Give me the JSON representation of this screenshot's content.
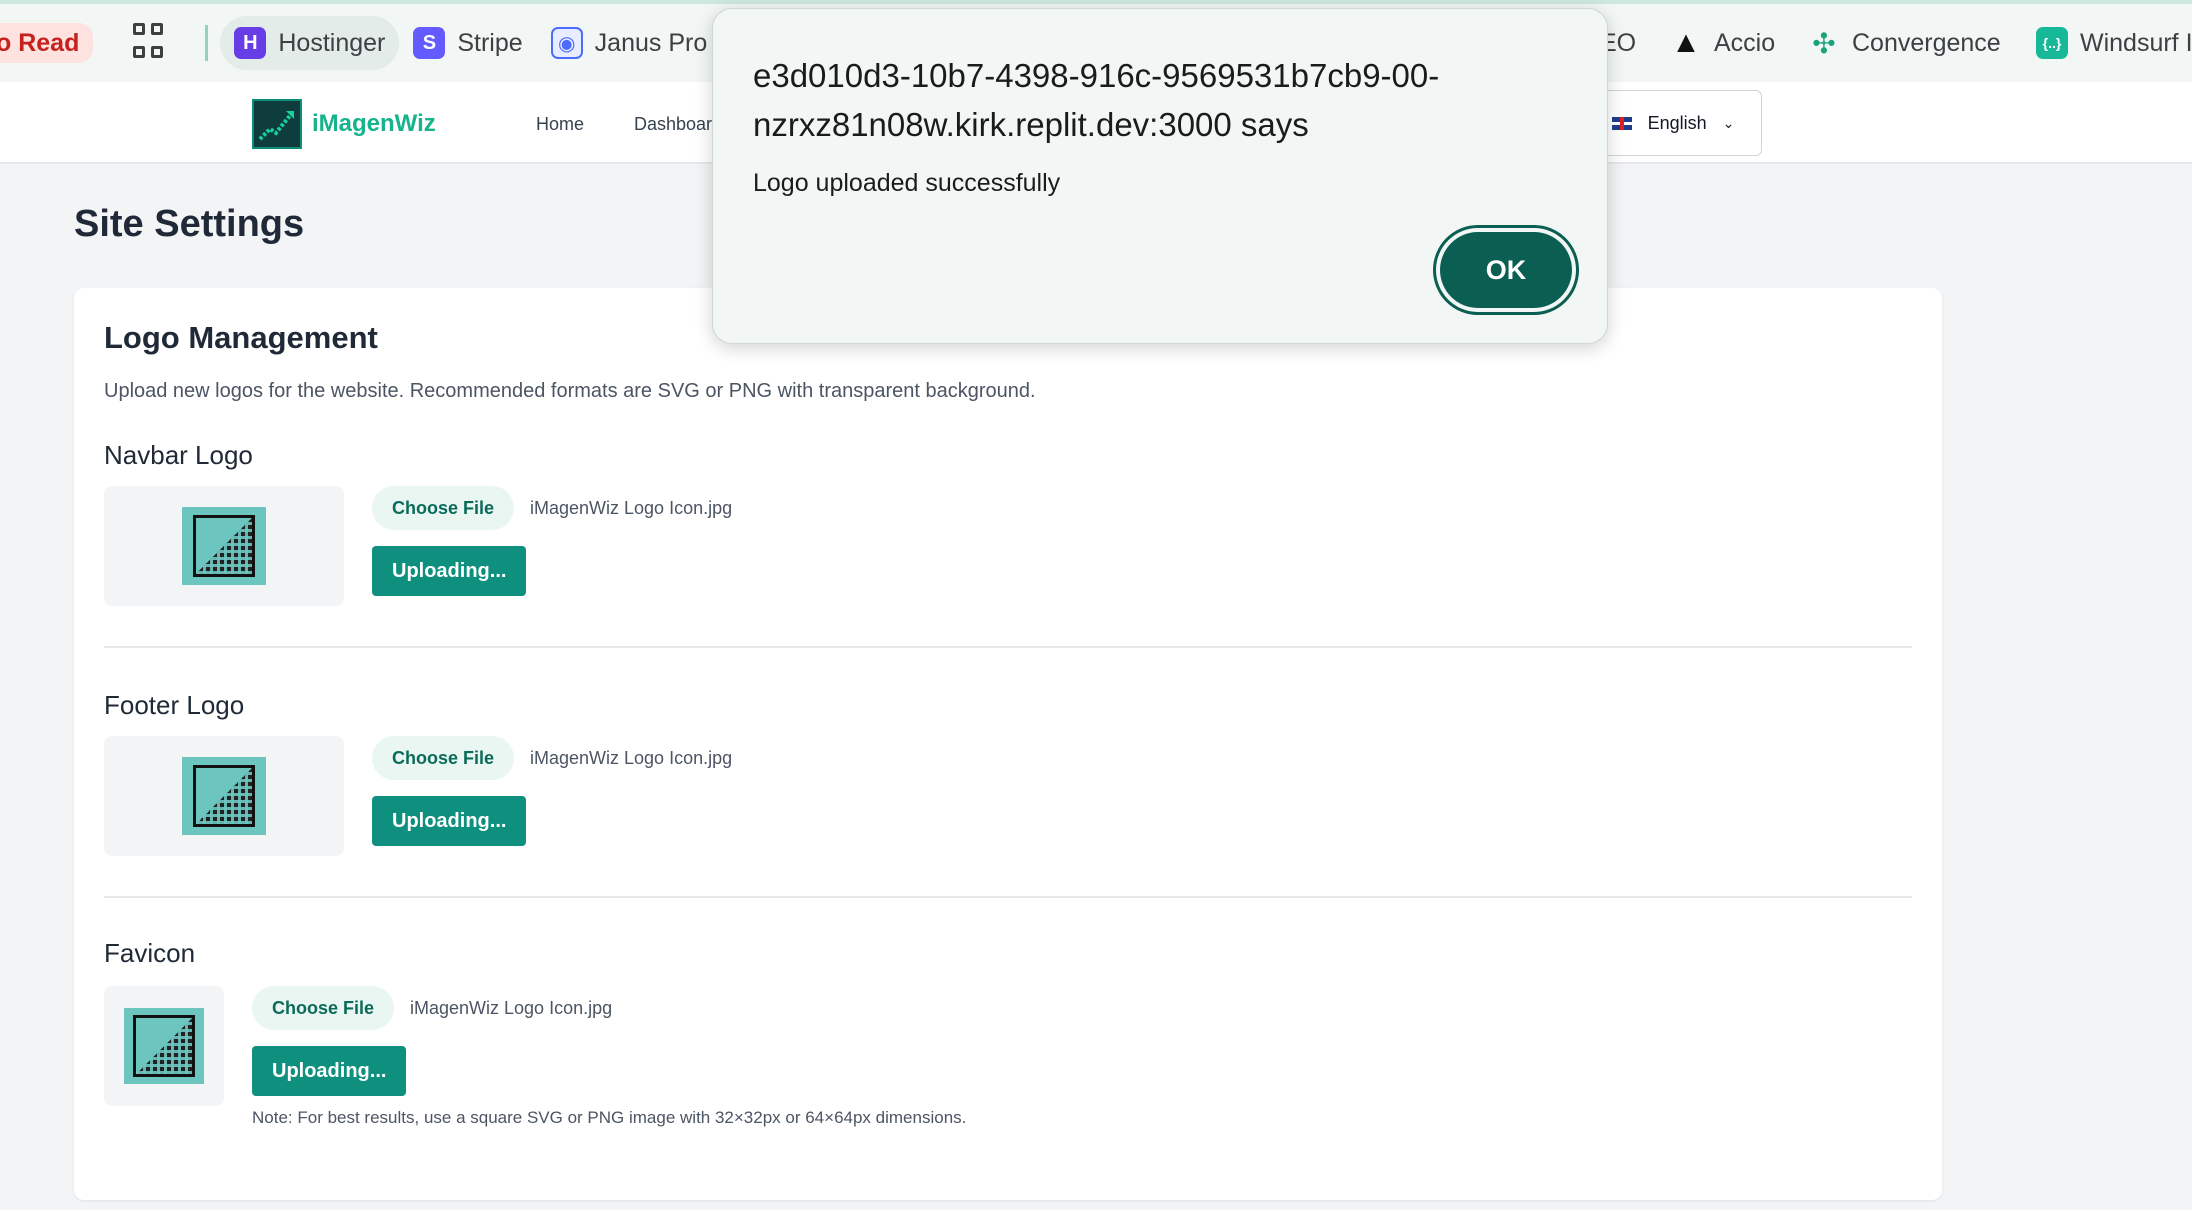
{
  "bookmarks": [
    {
      "label": "o Read"
    },
    {
      "label": "Hostinger",
      "icon": "hostinger-icon",
      "color": "#673de6"
    },
    {
      "label": "Stripe",
      "icon": "stripe-icon",
      "color": "#635bff"
    },
    {
      "label": "Janus Pro",
      "icon": "janus-icon",
      "color": "#4d6bfe"
    },
    {
      "label": "EO"
    },
    {
      "label": "Accio",
      "icon": "accio-icon",
      "color": "#111111"
    },
    {
      "label": "Convergence",
      "icon": "convergence-icon",
      "color": "#1aa37a"
    },
    {
      "label": "Windsurf I",
      "icon": "windsurf-icon",
      "color": "#17b897"
    }
  ],
  "navbar": {
    "brand": "iMagenWiz",
    "links": [
      "Home",
      "Dashboar"
    ],
    "language": "English"
  },
  "page": {
    "title": "Site Settings"
  },
  "logo_management": {
    "title": "Logo Management",
    "description": "Upload new logos for the website. Recommended formats are SVG or PNG with transparent background.",
    "sections": [
      {
        "title": "Navbar Logo",
        "choose_label": "Choose File",
        "file_name": "iMagenWiz Logo Icon.jpg",
        "upload_label": "Uploading..."
      },
      {
        "title": "Footer Logo",
        "choose_label": "Choose File",
        "file_name": "iMagenWiz Logo Icon.jpg",
        "upload_label": "Uploading..."
      },
      {
        "title": "Favicon",
        "choose_label": "Choose File",
        "file_name": "iMagenWiz Logo Icon.jpg",
        "upload_label": "Uploading...",
        "note": "Note: For best results, use a square SVG or PNG image with 32×32px or 64×64px dimensions."
      }
    ]
  },
  "dialog": {
    "title": "e3d010d3-10b7-4398-916c-9569531b7cb9-00-nzrxz81n08w.kirk.replit.dev:3000 says",
    "message": "Logo uploaded successfully",
    "ok_label": "OK"
  },
  "colors": {
    "accent": "#0f8f7d",
    "brand": "#16b38c",
    "dialog_button": "#0b5e52"
  }
}
